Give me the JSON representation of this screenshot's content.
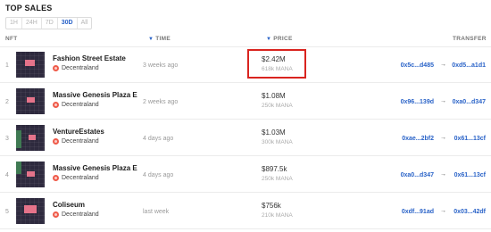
{
  "title": "TOP SALES",
  "filters": [
    "1H",
    "24H",
    "7D",
    "30D",
    "All"
  ],
  "active_filter": "30D",
  "columns": {
    "nft": "NFT",
    "time": "TIME",
    "price": "PRICE",
    "transfer": "TRANSFER"
  },
  "rows": [
    {
      "rank": "1",
      "name": "Fashion Street Estate",
      "owner": "Decentraland",
      "time": "3 weeks ago",
      "price": "$2.42M",
      "mana": "618k MANA",
      "from": "0x5c...d485",
      "arrow": "→",
      "to": "0xd5...a1d1"
    },
    {
      "rank": "2",
      "name": "Massive Genesis Plaza E",
      "owner": "Decentraland",
      "time": "2 weeks ago",
      "price": "$1.08M",
      "mana": "250k MANA",
      "from": "0x96...139d",
      "arrow": "→",
      "to": "0xa0...d347"
    },
    {
      "rank": "3",
      "name": "VentureEstates",
      "owner": "Decentraland",
      "time": "4 days ago",
      "price": "$1.03M",
      "mana": "300k MANA",
      "from": "0xae...2bf2",
      "arrow": "→",
      "to": "0x61...13cf"
    },
    {
      "rank": "4",
      "name": "Massive Genesis Plaza E",
      "owner": "Decentraland",
      "time": "4 days ago",
      "price": "$897.5k",
      "mana": "250k MANA",
      "from": "0xa0...d347",
      "arrow": "→",
      "to": "0x61...13cf"
    },
    {
      "rank": "5",
      "name": "Coliseum",
      "owner": "Decentraland",
      "time": "last week",
      "price": "$756k",
      "mana": "210k MANA",
      "from": "0xdf...91ad",
      "arrow": "→",
      "to": "0x03...42df"
    }
  ],
  "colors": {
    "accent": "#2a63c8",
    "highlight": "#d9241f",
    "decentraland": "#ef5b4a"
  }
}
